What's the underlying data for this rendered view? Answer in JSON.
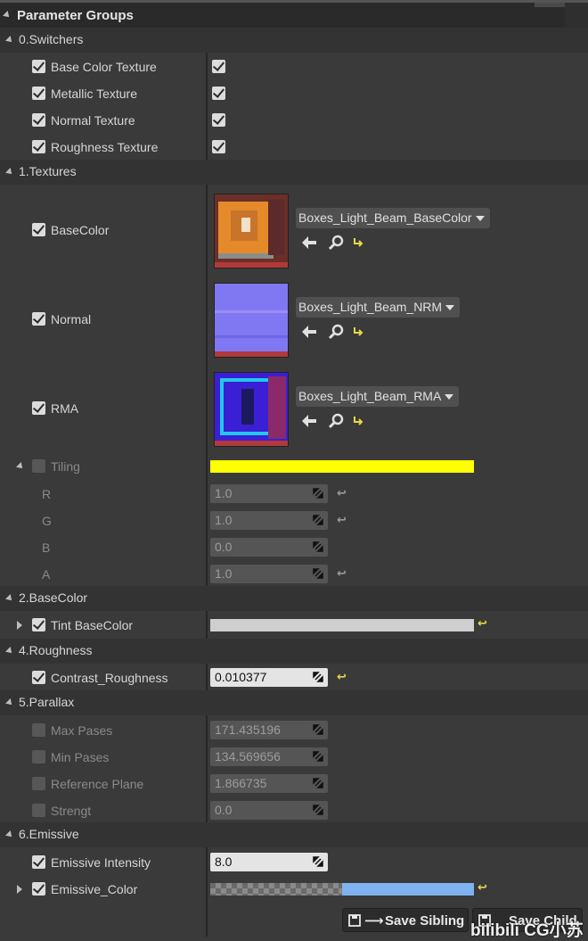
{
  "panel": {
    "title": "Parameter Groups"
  },
  "groups": {
    "switchers": {
      "label": "0.Switchers",
      "items": [
        {
          "label": "Base Color Texture",
          "enabled": true,
          "value": true
        },
        {
          "label": "Metallic Texture",
          "enabled": true,
          "value": true
        },
        {
          "label": "Normal Texture",
          "enabled": true,
          "value": true
        },
        {
          "label": "Roughness Texture",
          "enabled": true,
          "value": true
        }
      ]
    },
    "textures": {
      "label": "1.Textures",
      "items": [
        {
          "label": "BaseColor",
          "asset": "Boxes_Light_Beam_BaseColor",
          "thumb_color": "#e08a2a"
        },
        {
          "label": "Normal",
          "asset": "Boxes_Light_Beam_NRM",
          "thumb_color": "#7a72f0"
        },
        {
          "label": "RMA",
          "asset": "Boxes_Light_Beam_RMA",
          "thumb_color": "#3a1fd8"
        }
      ],
      "tiling": {
        "label": "Tiling",
        "color": "#ffff00",
        "channels": [
          {
            "label": "R",
            "value": "1.0"
          },
          {
            "label": "G",
            "value": "1.0"
          },
          {
            "label": "B",
            "value": "0.0"
          },
          {
            "label": "A",
            "value": "1.0"
          }
        ]
      }
    },
    "basecolor": {
      "label": "2.BaseColor",
      "tint": {
        "label": "Tint BaseColor",
        "color": "#cfcfcf"
      }
    },
    "roughness": {
      "label": "4.Roughness",
      "contrast": {
        "label": "Contrast_Roughness",
        "value": "0.010377"
      }
    },
    "parallax": {
      "label": "5.Parallax",
      "items": [
        {
          "label": "Max Pases",
          "value": "171.435196"
        },
        {
          "label": "Min Pases",
          "value": "134.569656"
        },
        {
          "label": "Reference Plane",
          "value": "1.866735"
        },
        {
          "label": "Strengt",
          "value": "0.0"
        }
      ]
    },
    "emissive": {
      "label": "6.Emissive",
      "intensity": {
        "label": "Emissive Intensity",
        "value": "8.0"
      },
      "color": {
        "label": "Emissive_Color",
        "color": "#7fb2f0"
      }
    }
  },
  "footer": {
    "save_sibling": "Save Sibling",
    "save_child": "Save Child"
  },
  "watermark": "bilibili CG小苏",
  "colors": {
    "reset_arrow": "#e8d84a",
    "accent_yellow": "#ffff00"
  },
  "icons": [
    "browse-arrow-icon",
    "search-icon",
    "reset-arrow-icon",
    "drag-handle-icon",
    "save-icon"
  ]
}
